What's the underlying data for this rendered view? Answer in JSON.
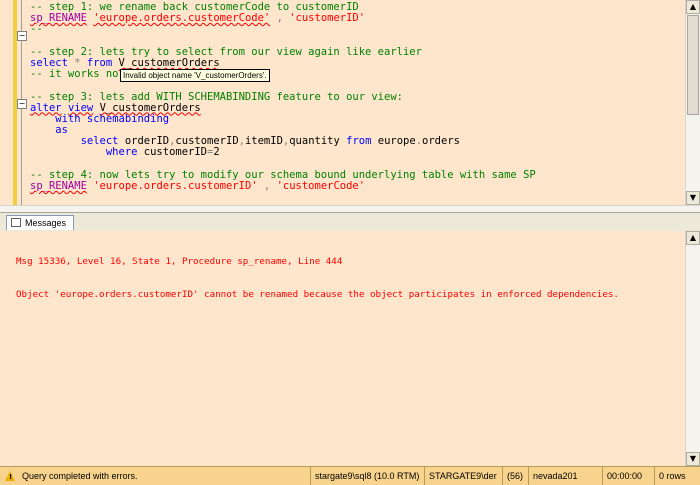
{
  "editor": {
    "lines": [
      [
        {
          "t": "-- step 1: we rename back customerCode to customerID",
          "c": "c"
        }
      ],
      [
        {
          "t": "sp_RENAME",
          "c": "m sq"
        },
        {
          "t": " ",
          "c": ""
        },
        {
          "t": "'europe.orders.customerCode'",
          "c": "s sq"
        },
        {
          "t": " , ",
          "c": "g"
        },
        {
          "t": "'customerID'",
          "c": "s"
        }
      ],
      [
        {
          "t": "--",
          "c": "c"
        }
      ],
      [
        {
          "t": "",
          "c": ""
        }
      ],
      [
        {
          "t": "-- step 2: lets try to select from our view again like earlier",
          "c": "c"
        }
      ],
      [
        {
          "t": "select",
          "c": "k"
        },
        {
          "t": " * ",
          "c": "g"
        },
        {
          "t": "from",
          "c": "k"
        },
        {
          "t": " ",
          "c": ""
        },
        {
          "t": "V_customerOrders",
          "c": "sq"
        }
      ],
      [
        {
          "t": "-- it works no",
          "c": "c"
        }
      ],
      [
        {
          "t": "",
          "c": ""
        }
      ],
      [
        {
          "t": "-- step 3: lets add WITH SCHEMABINDING feature to our view:",
          "c": "c"
        }
      ],
      [
        {
          "t": "alter",
          "c": "k sq"
        },
        {
          "t": " ",
          "c": ""
        },
        {
          "t": "view",
          "c": "k sq"
        },
        {
          "t": " ",
          "c": ""
        },
        {
          "t": "V_customerOrders",
          "c": "sq"
        }
      ],
      [
        {
          "t": "    ",
          "c": ""
        },
        {
          "t": "with schemabinding",
          "c": "k"
        }
      ],
      [
        {
          "t": "    ",
          "c": ""
        },
        {
          "t": "as",
          "c": "k"
        }
      ],
      [
        {
          "t": "        ",
          "c": ""
        },
        {
          "t": "select",
          "c": "k"
        },
        {
          "t": " orderID",
          "c": ""
        },
        {
          "t": ",",
          "c": "g"
        },
        {
          "t": "customerID",
          "c": ""
        },
        {
          "t": ",",
          "c": "g"
        },
        {
          "t": "itemID",
          "c": ""
        },
        {
          "t": ",",
          "c": "g"
        },
        {
          "t": "quantity ",
          "c": ""
        },
        {
          "t": "from",
          "c": "k"
        },
        {
          "t": " europe",
          "c": ""
        },
        {
          "t": ".",
          "c": "g"
        },
        {
          "t": "orders",
          "c": ""
        }
      ],
      [
        {
          "t": "            ",
          "c": ""
        },
        {
          "t": "where",
          "c": "k"
        },
        {
          "t": " customerID",
          "c": ""
        },
        {
          "t": "=",
          "c": "g"
        },
        {
          "t": "2",
          "c": ""
        }
      ],
      [
        {
          "t": "",
          "c": ""
        }
      ],
      [
        {
          "t": "-- step 4: now lets try to modify our schema bound underlying table with same SP",
          "c": "c"
        }
      ],
      [
        {
          "t": "sp_RENAME",
          "c": "m sq"
        },
        {
          "t": " ",
          "c": ""
        },
        {
          "t": "'europe.orders.customerID'",
          "c": "s"
        },
        {
          "t": " , ",
          "c": "g"
        },
        {
          "t": "'customerCode'",
          "c": "s"
        }
      ]
    ],
    "tooltip": "Invalid object name 'V_customerOrders'."
  },
  "messages_tab": {
    "label": "Messages"
  },
  "messages": [
    "Msg 15336, Level 16, State 1, Procedure sp_rename, Line 444",
    "Object 'europe.orders.customerID' cannot be renamed because the object participates in enforced dependencies."
  ],
  "status": {
    "query_status": "Query completed with errors.",
    "server": "stargate9\\sql8 (10.0 RTM)",
    "user": "STARGATE9\\der",
    "spid": "(56)",
    "database": "nevada201",
    "elapsed": "00:00:00",
    "rows": "0 rows"
  },
  "scroll": {
    "up_arrow": "▲",
    "down_arrow": "▼"
  },
  "collapse_symbol": "−"
}
